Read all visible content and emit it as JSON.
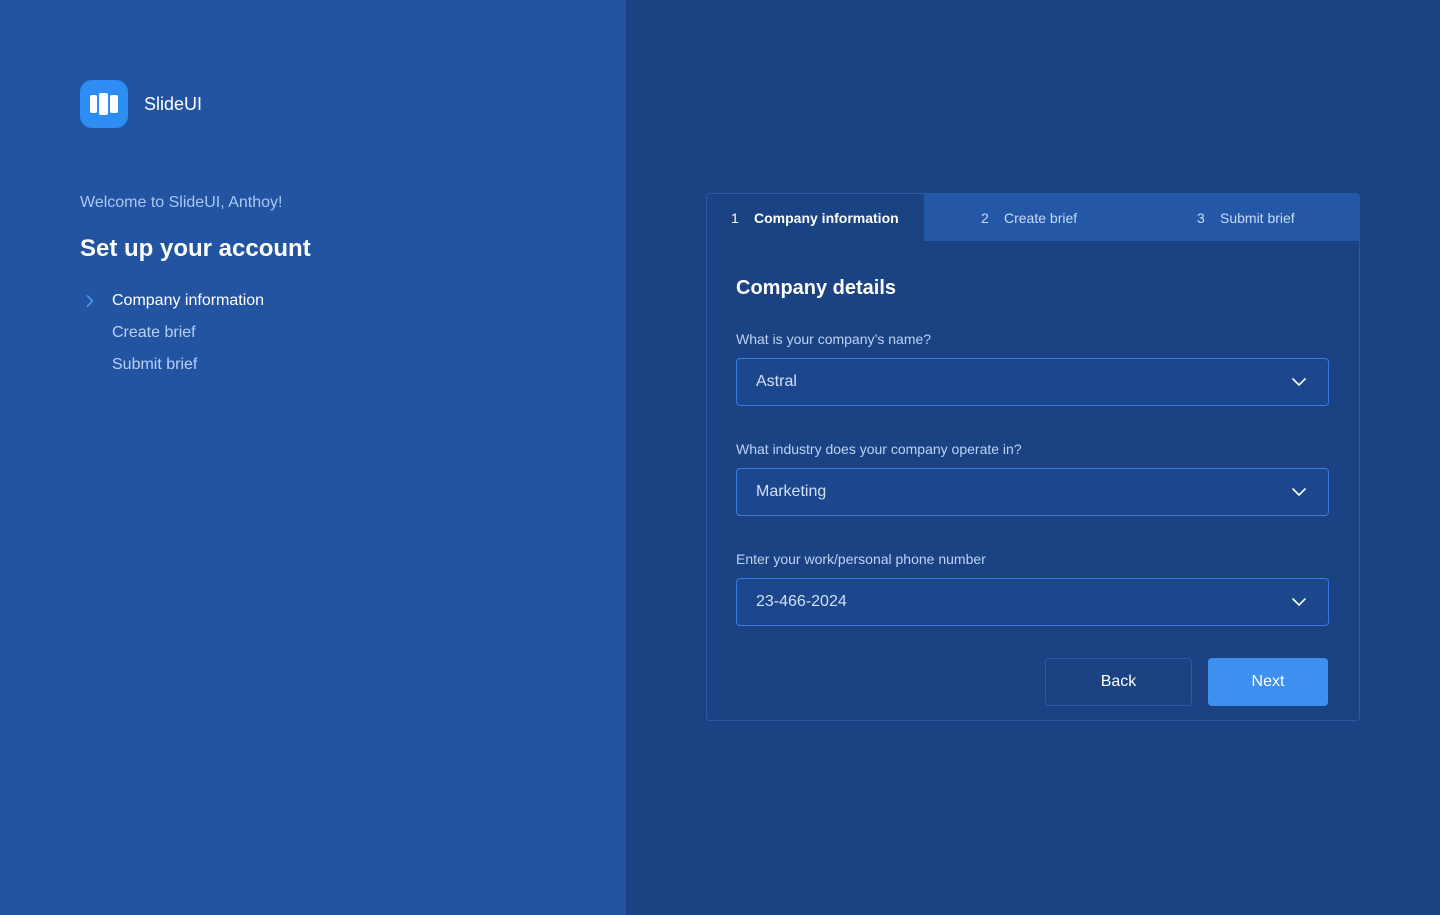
{
  "brand": {
    "name": "SlideUI",
    "accent": "#2d8df2"
  },
  "sidebar": {
    "welcome": "Welcome to SlideUI, Anthoy!",
    "title": "Set up your account",
    "steps": [
      {
        "label": "Company information",
        "active": true
      },
      {
        "label": "Create brief",
        "active": false
      },
      {
        "label": "Submit brief",
        "active": false
      }
    ]
  },
  "tabs": [
    {
      "number": "1",
      "label": "Company information",
      "active": true
    },
    {
      "number": "2",
      "label": "Create brief",
      "active": false
    },
    {
      "number": "3",
      "label": "Submit brief",
      "active": false
    }
  ],
  "form": {
    "title": "Company details",
    "fields": [
      {
        "label": "What is your company’s name?",
        "value": "Astral",
        "icon": "chevron-down-icon"
      },
      {
        "label": "What industry does your company operate in?",
        "value": "Marketing",
        "icon": "chevron-down-icon"
      },
      {
        "label": "Enter your work/personal phone number",
        "value": "23-466-2024",
        "icon": "chevron-down-icon"
      }
    ],
    "back_label": "Back",
    "next_label": "Next"
  },
  "colors": {
    "left_panel": "#2254a2",
    "right_panel": "#1b4283",
    "primary_button": "#3d8ff0"
  }
}
